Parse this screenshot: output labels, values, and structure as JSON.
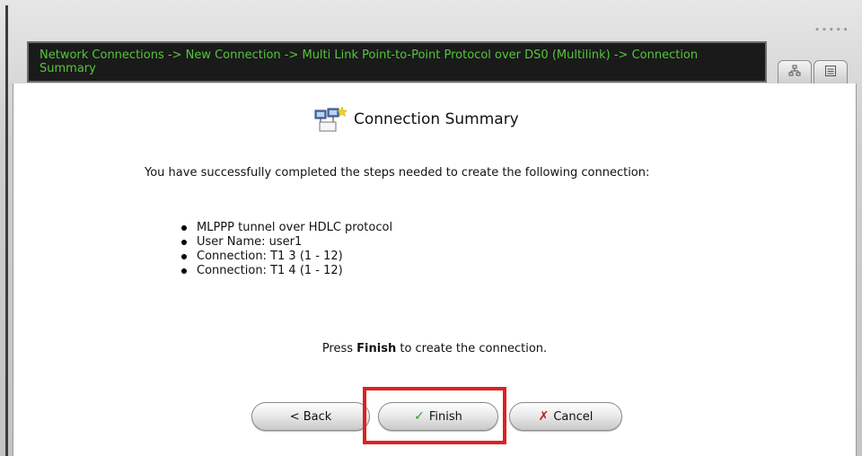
{
  "breadcrumb": "Network Connections -> New Connection -> Multi Link Point-to-Point Protocol over DS0 (Multilink) -> Connection Summary",
  "tabs": [
    {
      "icon": "network-map-icon"
    },
    {
      "icon": "list-view-icon"
    }
  ],
  "page_title": "Connection Summary",
  "intro_text": "You have successfully completed the steps needed to create the following connection:",
  "summary_items": [
    "MLPPP tunnel over HDLC protocol",
    "User Name: user1",
    "Connection: T1 3 (1 - 12)",
    "Connection: T1 4 (1 - 12)"
  ],
  "instruction": {
    "prefix": "Press ",
    "emphasis": "Finish",
    "suffix": " to create the connection."
  },
  "buttons": {
    "back": "< Back",
    "finish": "Finish",
    "cancel": "Cancel"
  },
  "colors": {
    "breadcrumb_text": "#55c63a",
    "breadcrumb_bg": "#1a1a1a",
    "finish_check": "#2a9a2a",
    "cancel_x": "#c41818",
    "highlight_box": "#e02020"
  }
}
